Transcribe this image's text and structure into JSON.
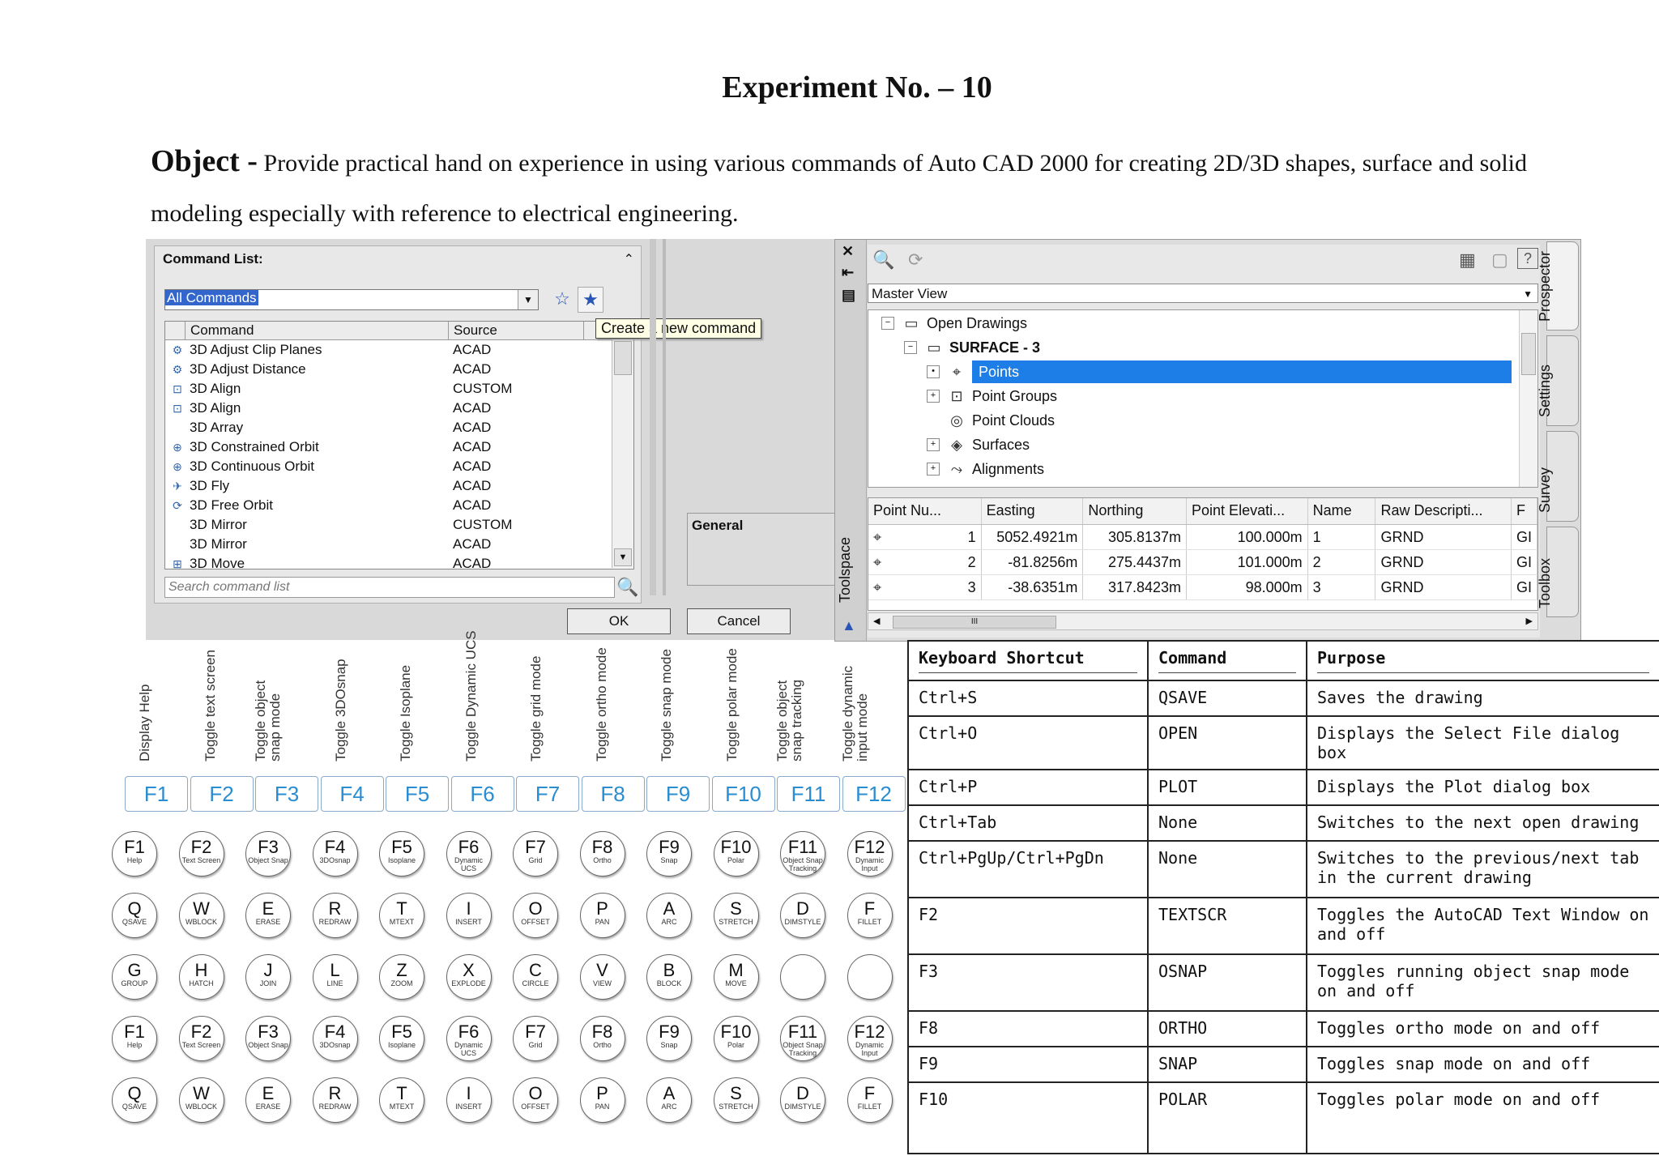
{
  "title": "Experiment No. – 10",
  "objective": {
    "label": "Object -",
    "text": "Provide practical hand on experience in using various commands of Auto CAD 2000 for creating 2D/3D shapes, surface and solid modeling especially with reference to electrical engineering."
  },
  "command_dialog": {
    "panel_title": "Command List:",
    "filter_value": "All Commands",
    "tooltip": "Create a new command",
    "columns": [
      "Command",
      "Source"
    ],
    "rows": [
      {
        "command": "3D Adjust Clip Planes",
        "source": "ACAD"
      },
      {
        "command": "3D Adjust Distance",
        "source": "ACAD"
      },
      {
        "command": "3D Align",
        "source": "CUSTOM"
      },
      {
        "command": "3D Align",
        "source": "ACAD"
      },
      {
        "command": "3D Array",
        "source": "ACAD"
      },
      {
        "command": "3D Constrained Orbit",
        "source": "ACAD"
      },
      {
        "command": "3D Continuous Orbit",
        "source": "ACAD"
      },
      {
        "command": "3D Fly",
        "source": "ACAD"
      },
      {
        "command": "3D Free Orbit",
        "source": "ACAD"
      },
      {
        "command": "3D Mirror",
        "source": "CUSTOM"
      },
      {
        "command": "3D Mirror",
        "source": "ACAD"
      },
      {
        "command": "3D Move",
        "source": "ACAD"
      }
    ],
    "search_placeholder": "Search command list",
    "general_label": "General",
    "ok_label": "OK",
    "cancel_label": "Cancel"
  },
  "toolspace": {
    "label": "Toolspace",
    "view_select": "Master View",
    "tree": [
      {
        "label": "Open Drawings",
        "level": 0,
        "expander": "⊟"
      },
      {
        "label": "SURFACE - 3",
        "level": 1,
        "expander": "⊟"
      },
      {
        "label": "Points",
        "level": 2,
        "expander": "●",
        "selected": true
      },
      {
        "label": "Point Groups",
        "level": 2,
        "expander": "⊞"
      },
      {
        "label": "Point Clouds",
        "level": 2,
        "expander": ""
      },
      {
        "label": "Surfaces",
        "level": 2,
        "expander": "⊞"
      },
      {
        "label": "Alignments",
        "level": 2,
        "expander": "⊞"
      }
    ],
    "grid_columns": [
      "Point Nu...",
      "Easting",
      "Northing",
      "Point Elevati...",
      "Name",
      "Raw Descripti...",
      "F"
    ],
    "grid_rows": [
      [
        "1",
        "5052.4921m",
        "305.8137m",
        "100.000m",
        "1",
        "GRND",
        "GI"
      ],
      [
        "2",
        "-81.8256m",
        "275.4437m",
        "101.000m",
        "2",
        "GRND",
        "GI"
      ],
      [
        "3",
        "-38.6351m",
        "317.8423m",
        "98.000m",
        "3",
        "GRND",
        "GI"
      ]
    ],
    "side_tabs": [
      "Prospector",
      "Settings",
      "Survey",
      "Toolbox"
    ],
    "hscroll_grip": "III"
  },
  "function_keys": [
    {
      "key": "F1",
      "label": "Display Help"
    },
    {
      "key": "F2",
      "label": "Toggle text screen"
    },
    {
      "key": "F3",
      "label": "Toggle object\nsnap mode"
    },
    {
      "key": "F4",
      "label": "Toggle 3DOsnap"
    },
    {
      "key": "F5",
      "label": "Toggle Isoplane"
    },
    {
      "key": "F6",
      "label": "Toggle Dynamic UCS"
    },
    {
      "key": "F7",
      "label": "Toggle grid mode"
    },
    {
      "key": "F8",
      "label": "Toggle ortho mode"
    },
    {
      "key": "F9",
      "label": "Toggle snap mode"
    },
    {
      "key": "F10",
      "label": "Toggle polar mode"
    },
    {
      "key": "F11",
      "label": "Toggle object\nsnap tracking"
    },
    {
      "key": "F12",
      "label": "Toggle dynamic\ninput mode"
    }
  ],
  "key_rows": [
    [
      [
        "F1",
        "Help"
      ],
      [
        "F2",
        "Text Screen"
      ],
      [
        "F3",
        "Object Snap"
      ],
      [
        "F4",
        "3DOsnap"
      ],
      [
        "F5",
        "Isoplane"
      ],
      [
        "F6",
        "Dynamic UCS"
      ],
      [
        "F7",
        "Grid"
      ],
      [
        "F8",
        "Ortho"
      ],
      [
        "F9",
        "Snap"
      ],
      [
        "F10",
        "Polar"
      ],
      [
        "F11",
        "Object Snap Tracking"
      ],
      [
        "F12",
        "Dynamic Input"
      ]
    ],
    [
      [
        "Q",
        "QSAVE"
      ],
      [
        "W",
        "WBLOCK"
      ],
      [
        "E",
        "ERASE"
      ],
      [
        "R",
        "REDRAW"
      ],
      [
        "T",
        "MTEXT"
      ],
      [
        "I",
        "INSERT"
      ],
      [
        "O",
        "OFFSET"
      ],
      [
        "P",
        "PAN"
      ],
      [
        "A",
        "ARC"
      ],
      [
        "S",
        "STRETCH"
      ],
      [
        "D",
        "DIMSTYLE"
      ],
      [
        "F",
        "FILLET"
      ]
    ],
    [
      [
        "G",
        "GROUP"
      ],
      [
        "H",
        "HATCH"
      ],
      [
        "J",
        "JOIN"
      ],
      [
        "L",
        "LINE"
      ],
      [
        "Z",
        "ZOOM"
      ],
      [
        "X",
        "EXPLODE"
      ],
      [
        "C",
        "CIRCLE"
      ],
      [
        "V",
        "VIEW"
      ],
      [
        "B",
        "BLOCK"
      ],
      [
        "M",
        "MOVE"
      ],
      [
        "",
        ""
      ],
      [
        "",
        ""
      ]
    ],
    [
      [
        "F1",
        "Help"
      ],
      [
        "F2",
        "Text Screen"
      ],
      [
        "F3",
        "Object Snap"
      ],
      [
        "F4",
        "3DOsnap"
      ],
      [
        "F5",
        "Isoplane"
      ],
      [
        "F6",
        "Dynamic UCS"
      ],
      [
        "F7",
        "Grid"
      ],
      [
        "F8",
        "Ortho"
      ],
      [
        "F9",
        "Snap"
      ],
      [
        "F10",
        "Polar"
      ],
      [
        "F11",
        "Object Snap Tracking"
      ],
      [
        "F12",
        "Dynamic Input"
      ]
    ],
    [
      [
        "Q",
        "QSAVE"
      ],
      [
        "W",
        "WBLOCK"
      ],
      [
        "E",
        "ERASE"
      ],
      [
        "R",
        "REDRAW"
      ],
      [
        "T",
        "MTEXT"
      ],
      [
        "I",
        "INSERT"
      ],
      [
        "O",
        "OFFSET"
      ],
      [
        "P",
        "PAN"
      ],
      [
        "A",
        "ARC"
      ],
      [
        "S",
        "STRETCH"
      ],
      [
        "D",
        "DIMSTYLE"
      ],
      [
        "F",
        "FILLET"
      ]
    ]
  ],
  "shortcut_table": {
    "headers": [
      "Keyboard Shortcut",
      "Command",
      "Purpose"
    ],
    "rows": [
      [
        "Ctrl+S",
        "QSAVE",
        "Saves the drawing"
      ],
      [
        "Ctrl+O",
        "OPEN",
        "Displays the Select File dialog box"
      ],
      [
        "Ctrl+P",
        "PLOT",
        "Displays the  Plot dialog box"
      ],
      [
        "Ctrl+Tab",
        "None",
        "Switches to the next open drawing"
      ],
      [
        "Ctrl+PgUp/Ctrl+PgDn",
        "None",
        "Switches to the previous/next tab in the current drawing"
      ],
      [
        "F2",
        "TEXTSCR",
        "Toggles the AutoCAD Text Window on and off"
      ],
      [
        "F3",
        "OSNAP",
        "Toggles running object snap mode on and off"
      ],
      [
        "F8",
        "ORTHO",
        "Toggles ortho mode on and off"
      ],
      [
        "F9",
        "SNAP",
        "Toggles snap mode on and off"
      ],
      [
        "F10",
        "POLAR",
        "Toggles polar mode on and off"
      ]
    ]
  }
}
